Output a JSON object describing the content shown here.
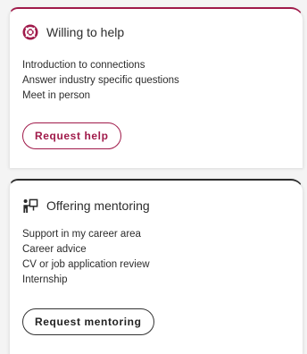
{
  "cards": {
    "help": {
      "icon": "lifebuoy-icon",
      "title": "Willing to help",
      "items": [
        "Introduction to connections",
        "Answer industry specific questions",
        "Meet in person"
      ],
      "button_label": "Request help",
      "accent_color": "#a01a4a"
    },
    "mentoring": {
      "icon": "presenter-board-icon",
      "title": "Offering mentoring",
      "items": [
        "Support in my career area",
        "Career advice",
        "CV or job application review",
        "Internship"
      ],
      "button_label": "Request mentoring",
      "accent_color": "#2b2b2b"
    }
  }
}
